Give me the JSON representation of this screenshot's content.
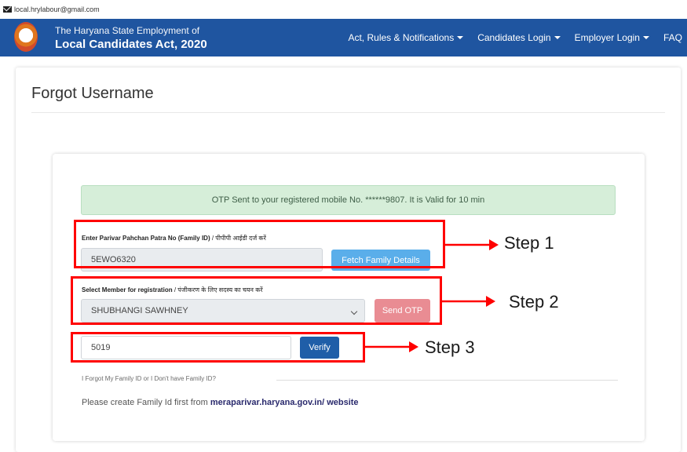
{
  "topbar": {
    "email": "local.hrylabour@gmail.com"
  },
  "brand": {
    "line1": "The Haryana State Employment of",
    "line2": "Local Candidates Act, 2020"
  },
  "nav": [
    {
      "label": "Act, Rules & Notifications"
    },
    {
      "label": "Candidates Login"
    },
    {
      "label": "Employer Login"
    },
    {
      "label": "FAQ"
    }
  ],
  "page": {
    "title": "Forgot Username"
  },
  "alert": {
    "text": "OTP Sent to your registered mobile No. ******9807. It is Valid for 10 min"
  },
  "family": {
    "label_bold": "Enter Parivar Pahchan Patra No (Family ID)",
    "label_rest": " / पीपीपी आईडी दर्ज करें",
    "value": "5EWO6320",
    "button": "Fetch Family Details"
  },
  "member": {
    "label_bold": "Select Member for registration",
    "label_rest": " / पंजीकरण के लिए सदस्य का चयन करें",
    "value": "SHUBHANGI SAWHNEY",
    "button": "Send OTP"
  },
  "otp": {
    "value": "5019",
    "button": "Verify"
  },
  "footer": {
    "forgot": "I Forgot My Family ID or I Don't have Family ID?",
    "note_prefix": "Please create Family Id first from ",
    "link": "meraparivar.haryana.gov.in/ website"
  },
  "steps": [
    "Step 1",
    "Step 2",
    "Step 3"
  ],
  "colors": {
    "nav": "#1f55a0",
    "annotation": "#ff0000",
    "fetch": "#5aaeea",
    "send": "#e98c93",
    "verify": "#1f5ea8"
  }
}
